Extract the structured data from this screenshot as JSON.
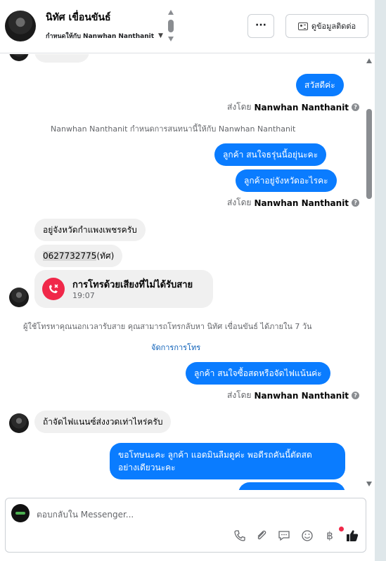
{
  "header": {
    "name": "นิทัศ เขื่อนขันธ์",
    "assigned": "กำหนดให้กับ Nanwhan Nanthanit",
    "more_label": "···",
    "contact_label": "ดูข้อมูลติดต่อ"
  },
  "messages": {
    "m1": "สวัสดีค่ะ",
    "sent_by_1": "ส่งโดย",
    "sender_1": "Nanwhan Nanthanit",
    "system_assign": "Nanwhan Nanthanit กำหนดการสนทนานี้ให้กับ Nanwhan Nanthanit",
    "m2": "ลูกค้า สนใจธรุ่นนี้อยุ่นะคะ",
    "m3": "ลูกค้าอยู่จังหวัดอะไรคะ",
    "sent_by_2": "ส่งโดย",
    "sender_2": "Nanwhan Nanthanit",
    "m4": "อยู่จังหวัดกำแพงเพชรครับ",
    "m5_phone": "0627732775",
    "m5_suffix": "(ทัศ)",
    "call_title": "การโทรด้วยเสียงที่ไม่ได้รับสาย",
    "call_time": "19:07",
    "system_call": "ผู้ใช้โทรหาคุณนอกเวลารับสาย คุณสามารถโทรกลับหา นิทัศ เขื่อนขันธ์ ได้ภายใน 7 วัน",
    "manage_calls": "จัดการการโทร",
    "m6": "ลูกค้า สนใจซื้อสดหรือจัดไฟแน้นค่ะ",
    "sent_by_3": "ส่งโดย",
    "sender_3": "Nanwhan Nanthanit",
    "m7": "ถ้าจัดไฟแนนซ์ส่งงวดเท่าไหร่ครับ",
    "m8_line1": "ขอโทษนะคะ ลูกค้า แอดมินลืมดูค่ะ พอดีรถคันนี้ตัดสด",
    "m8_line2": "อย่างเดียวนะคะ"
  },
  "composer": {
    "placeholder": "ตอบกลับใน Messenger..."
  },
  "colors": {
    "outgoing_bubble": "#0a7cff",
    "incoming_bubble": "#f0f0f0",
    "missed_call": "#f02849",
    "like": "#1c1e21"
  },
  "icons": [
    "chevron-up-icon",
    "chevron-down-icon",
    "more-icon",
    "contact-card-icon",
    "missed-call-icon",
    "phone-icon",
    "attachment-icon",
    "chat-icon",
    "emoji-icon",
    "baht-icon",
    "like-icon"
  ]
}
